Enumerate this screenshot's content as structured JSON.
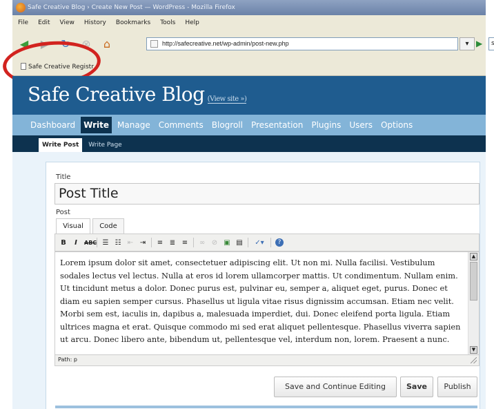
{
  "browser": {
    "window_title": "Safe Creative Blog › Create New Post — WordPress - Mozilla Firefox",
    "menu": [
      "File",
      "Edit",
      "View",
      "History",
      "Bookmarks",
      "Tools",
      "Help"
    ],
    "url": "http://safecreative.net/wp-admin/post-new.php",
    "search_value": "sta",
    "bookmark": "Safe Creative Registr",
    "annotation_color": "#d2231f"
  },
  "wp": {
    "blog_name": "Safe Creative Blog",
    "view_site": "(View site »)",
    "nav": [
      "Dashboard",
      "Write",
      "Manage",
      "Comments",
      "Blogroll",
      "Presentation",
      "Plugins",
      "Users",
      "Options"
    ],
    "nav_active": "Write",
    "subnav": [
      "Write Post",
      "Write Page"
    ],
    "subnav_active": "Write Post",
    "colors": {
      "header": "#1f5c8f",
      "nav": "#83b4d8",
      "active": "#0d324f"
    }
  },
  "form": {
    "title_label": "Title",
    "title_value": "Post Title",
    "post_label": "Post",
    "tabs": [
      "Visual",
      "Code"
    ],
    "toolbar_icons": [
      "bold-icon",
      "italic-icon",
      "strikethrough-icon",
      "bullet-list-icon",
      "numbered-list-icon",
      "outdent-icon",
      "indent-icon",
      "align-left-icon",
      "align-center-icon",
      "align-right-icon",
      "link-icon",
      "unlink-icon",
      "image-icon",
      "more-icon",
      "spellcheck-icon",
      "help-icon"
    ],
    "body": "Lorem ipsum dolor sit amet, consectetuer adipiscing elit. Ut non mi. Nulla facilisi. Vestibulum sodales lectus vel lectus. Nulla at eros id lorem ullamcorper mattis. Ut condimentum. Nullam enim. Ut tincidunt metus a dolor. Donec purus est, pulvinar eu, semper a, aliquet eget, purus. Donec et diam eu sapien semper cursus. Phasellus ut ligula vitae risus dignissim accumsan. Etiam nec velit. Morbi sem est, iaculis in, dapibus a, malesuada imperdiet, dui. Donec eleifend porta ligula. Etiam ultrices magna et erat. Quisque commodo mi sed erat aliquet pellentesque. Phasellus viverra sapien ut arcu. Donec libero ante, bibendum ut, pellentesque vel, interdum non, lorem. Praesent a nunc.",
    "path": "Path: p",
    "buttons": {
      "save_continue": "Save and Continue Editing",
      "save": "Save",
      "publish": "Publish"
    }
  }
}
